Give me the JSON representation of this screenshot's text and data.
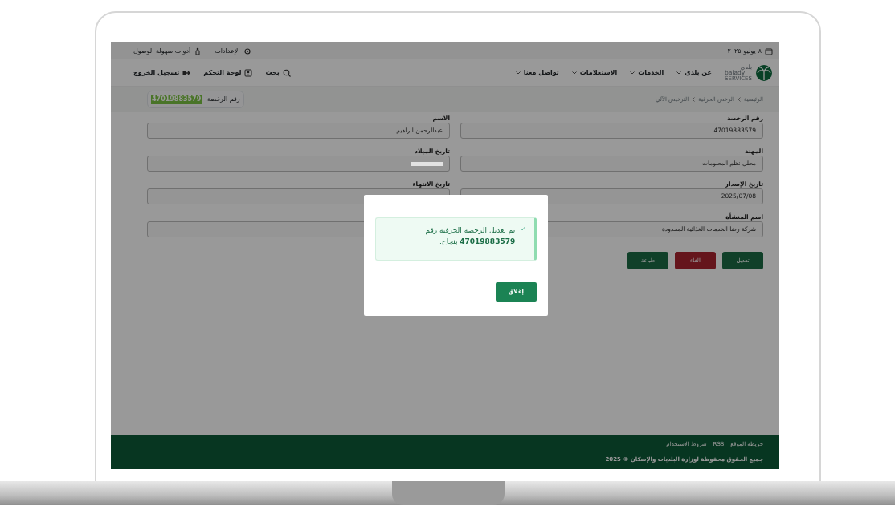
{
  "top_bar": {
    "date": "٨-يوليو-٢٠٢٥",
    "links": [
      {
        "label": "الإعدادات",
        "kind": "settings"
      },
      {
        "label": "أدوات سهولة الوصول",
        "kind": "accessibility"
      }
    ]
  },
  "navbar": {
    "logo": {
      "arabic": "بلدي",
      "latin": "balady",
      "tagline": "SERVICES"
    },
    "menu": [
      {
        "label": "عن بلدي",
        "has_dropdown": true
      },
      {
        "label": "الخدمات",
        "has_dropdown": true
      },
      {
        "label": "الاستعلامات",
        "has_dropdown": true
      },
      {
        "label": "تواصل معنا",
        "has_dropdown": true
      }
    ],
    "actions": [
      {
        "label": "بحث",
        "kind": "search"
      },
      {
        "label": "لوحة التحكم",
        "kind": "dashboard"
      },
      {
        "label": "تسجيل الخروج",
        "kind": "logout"
      }
    ]
  },
  "breadcrumb": [
    "الرئيسية",
    "الرخص الحرفية",
    "الترخيص الآلي"
  ],
  "license_badge": {
    "label": "رقم الرخصة:",
    "value": "47019883579"
  },
  "fields": [
    {
      "label": "رقم الرخصة",
      "value": "47019883579",
      "redacted": false
    },
    {
      "label": "الاسم",
      "value": "عبدالرحمن ابراهيم",
      "redacted": false
    },
    {
      "label": "المهنة",
      "value": "محلل نظم المعلومات",
      "redacted": false
    },
    {
      "label": "تاريخ الميلاد",
      "redacted": true
    },
    {
      "label": "تاريخ الإصدار",
      "value": "2025/07/08",
      "redacted": false
    },
    {
      "label": "تاريخ الانتهاء",
      "redacted": false
    },
    {
      "label": "اسم المنشأة",
      "value": "شركة رضا الخدمات الغذائية المحدودة",
      "redacted": false
    },
    {
      "redacted": false
    }
  ],
  "buttons": [
    {
      "label": "تعديل",
      "kind": "primary"
    },
    {
      "label": "الغاء",
      "kind": "danger"
    },
    {
      "label": "طباعة",
      "kind": "primary"
    }
  ],
  "footer": {
    "links": [
      "خريطة الموقع",
      "RSS",
      "شروط الاستخدام"
    ],
    "copyright": "جميع الحقوق محفوظة لوزارة البلديات والإسكان © 2025"
  },
  "modal": {
    "message": "تم تعديل الرخصة الحرفية رقم **47019883579** بنجاح.",
    "close_button": "إغلاق"
  }
}
